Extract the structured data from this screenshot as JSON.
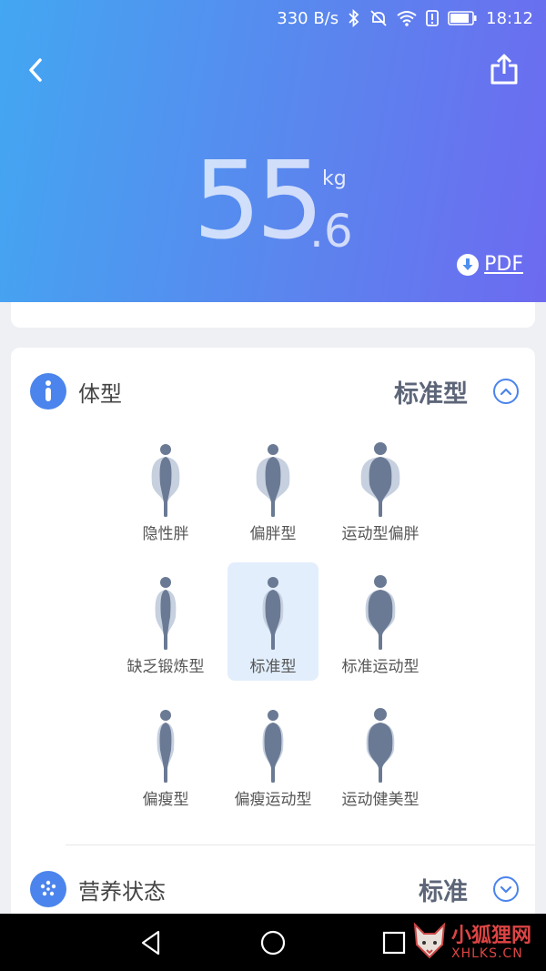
{
  "status_bar": {
    "speed": "330 B/s",
    "time": "18:12",
    "icons": [
      "bluetooth-icon",
      "mute-icon",
      "wifi-icon",
      "alert-icon",
      "battery-icon"
    ]
  },
  "header": {
    "back_icon": "chevron-left-icon",
    "share_icon": "share-icon",
    "weight_int": "55",
    "weight_dec": ".6",
    "weight_unit": "kg",
    "pdf_label": "PDF",
    "gradient": [
      "#43a7f2",
      "#6d6af0"
    ]
  },
  "body_type": {
    "title": "体型",
    "value": "标准型",
    "expanded": true,
    "types": [
      {
        "label": "隐性胖",
        "shape": "hidden-fat",
        "selected": false
      },
      {
        "label": "偏胖型",
        "shape": "overweight",
        "selected": false
      },
      {
        "label": "运动型偏胖",
        "shape": "athletic-fat",
        "selected": false
      },
      {
        "label": "缺乏锻炼型",
        "shape": "lack-exercise",
        "selected": false
      },
      {
        "label": "标准型",
        "shape": "standard",
        "selected": true
      },
      {
        "label": "标准运动型",
        "shape": "standard-athletic",
        "selected": false
      },
      {
        "label": "偏瘦型",
        "shape": "thin",
        "selected": false
      },
      {
        "label": "偏瘦运动型",
        "shape": "thin-athletic",
        "selected": false
      },
      {
        "label": "运动健美型",
        "shape": "bodybuilder",
        "selected": false
      }
    ]
  },
  "nutrition": {
    "title": "营养状态",
    "value": "标准",
    "expanded": false
  },
  "nav": [
    "back-triangle-icon",
    "home-circle-icon",
    "recents-square-icon"
  ],
  "watermark": {
    "line1": "小狐狸网",
    "line2": "XHLKS.CN"
  },
  "colors": {
    "accent": "#4b84ec",
    "selected_bg": "#e2eefc",
    "figure_dark": "#6b7a94",
    "figure_light": "#c6d0df"
  }
}
